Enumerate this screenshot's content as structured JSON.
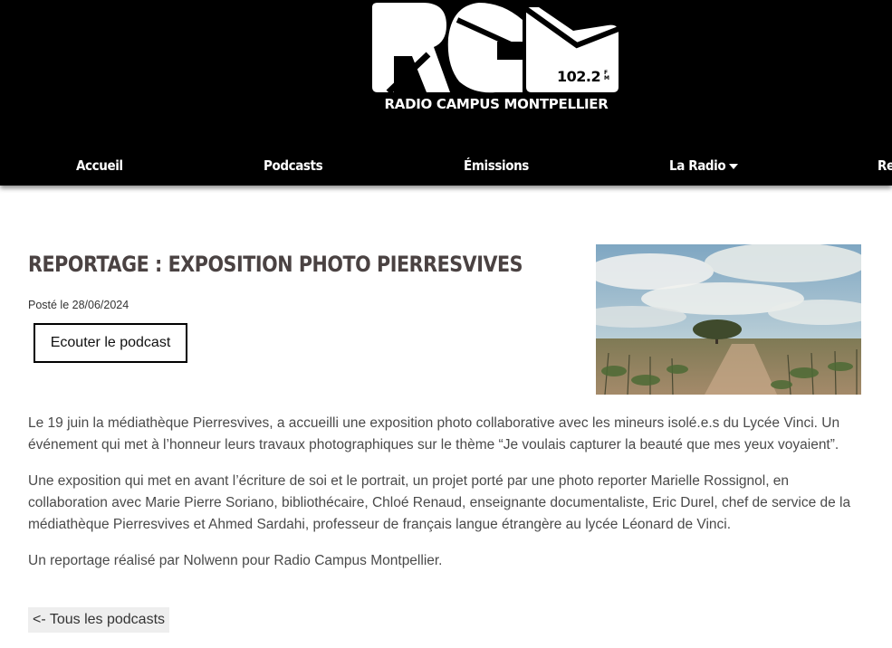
{
  "brand": {
    "frequency": "102.2",
    "frequency_unit": "FM",
    "name": "RADIO CAMPUS MONTPELLIER"
  },
  "nav": {
    "items": [
      {
        "label": "Accueil"
      },
      {
        "label": "Podcasts"
      },
      {
        "label": "Émissions"
      },
      {
        "label": "La Radio"
      },
      {
        "label": "Re"
      }
    ]
  },
  "article": {
    "title": "REPORTAGE : EXPOSITION PHOTO PIERRESVIVES",
    "date": "Posté le 28/06/2024",
    "listen_label": "Ecouter le podcast",
    "paragraphs": [
      "Le 19 juin la médiathèque Pierresvives, a accueilli une exposition photo collaborative avec les mineurs isolé.e.s du Lycée Vinci. Un événement qui met à l’honneur leurs travaux photographiques sur le thème “Je voulais capturer la beauté que mes yeux voyaient”.",
      "Une exposition qui met en avant l’écriture de soi et le portrait, un projet porté par une photo reporter Marielle Rossignol, en collaboration avec Marie Pierre Soriano, bibliothécaire, Chloé Renaud, enseignante documentaliste, Eric Durel, chef de service de la médiathèque Pierresvives et Ahmed Sardahi, professeur de français langue étrangère au lycée Léonard de Vinci.",
      "Un reportage réalisé par Nolwenn pour Radio Campus Montpellier."
    ]
  },
  "back_link": "<- Tous les podcasts",
  "icons": {
    "dropdown": "caret-down-icon"
  },
  "colors": {
    "header_bg": "#000000",
    "title": "#4a4242",
    "text": "#4a4a4a",
    "back_bg": "#eeeeee"
  }
}
